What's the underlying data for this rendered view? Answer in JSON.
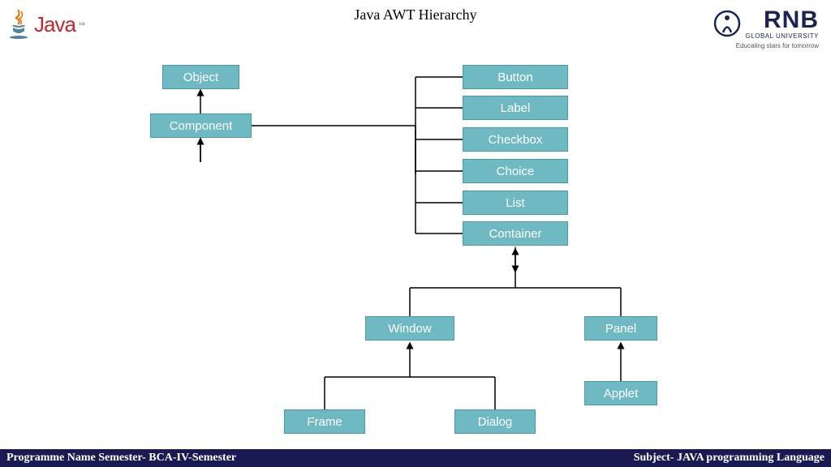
{
  "title": "Java AWT Hierarchy",
  "logos": {
    "java": "Java",
    "rnb_name": "RNB",
    "rnb_sub": "GLOBAL UNIVERSITY",
    "rnb_tag": "Educating stars for tomorrow"
  },
  "nodes": {
    "object": "Object",
    "component": "Component",
    "button": "Button",
    "label": "Label",
    "checkbox": "Checkbox",
    "choice": "Choice",
    "list": "List",
    "container": "Container",
    "window": "Window",
    "panel": "Panel",
    "frame": "Frame",
    "dialog": "Dialog",
    "applet": "Applet"
  },
  "footer": {
    "left": "Programme Name Semester- BCA-IV-Semester",
    "right": "Subject-  JAVA programming Language"
  }
}
